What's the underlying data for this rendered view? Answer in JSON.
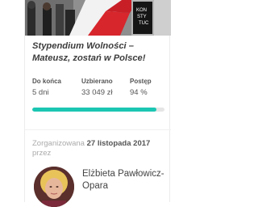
{
  "campaign": {
    "title": "Stypendium Wolności – Mateusz, zostań w Polsce!",
    "stats": [
      {
        "label": "Do końca",
        "value": "5 dni"
      },
      {
        "label": "Uzbierano",
        "value": "33 049 zł"
      },
      {
        "label": "Postęp",
        "value": "94 %"
      }
    ],
    "progress_fraction": 0.94
  },
  "organizer": {
    "prefix": "Zorganizowana",
    "date": "27 listopada 2017",
    "by": "przez",
    "name": "Elżbieta Pawłowicz-Opara"
  },
  "colors": {
    "accent": "#1bc6b3",
    "track": "#e5e5e5",
    "title": "#3c3c3c",
    "muted": "#aaaaaa"
  },
  "icons": {
    "hero_image": "street-march-photo",
    "avatar": "organizer-photo"
  }
}
